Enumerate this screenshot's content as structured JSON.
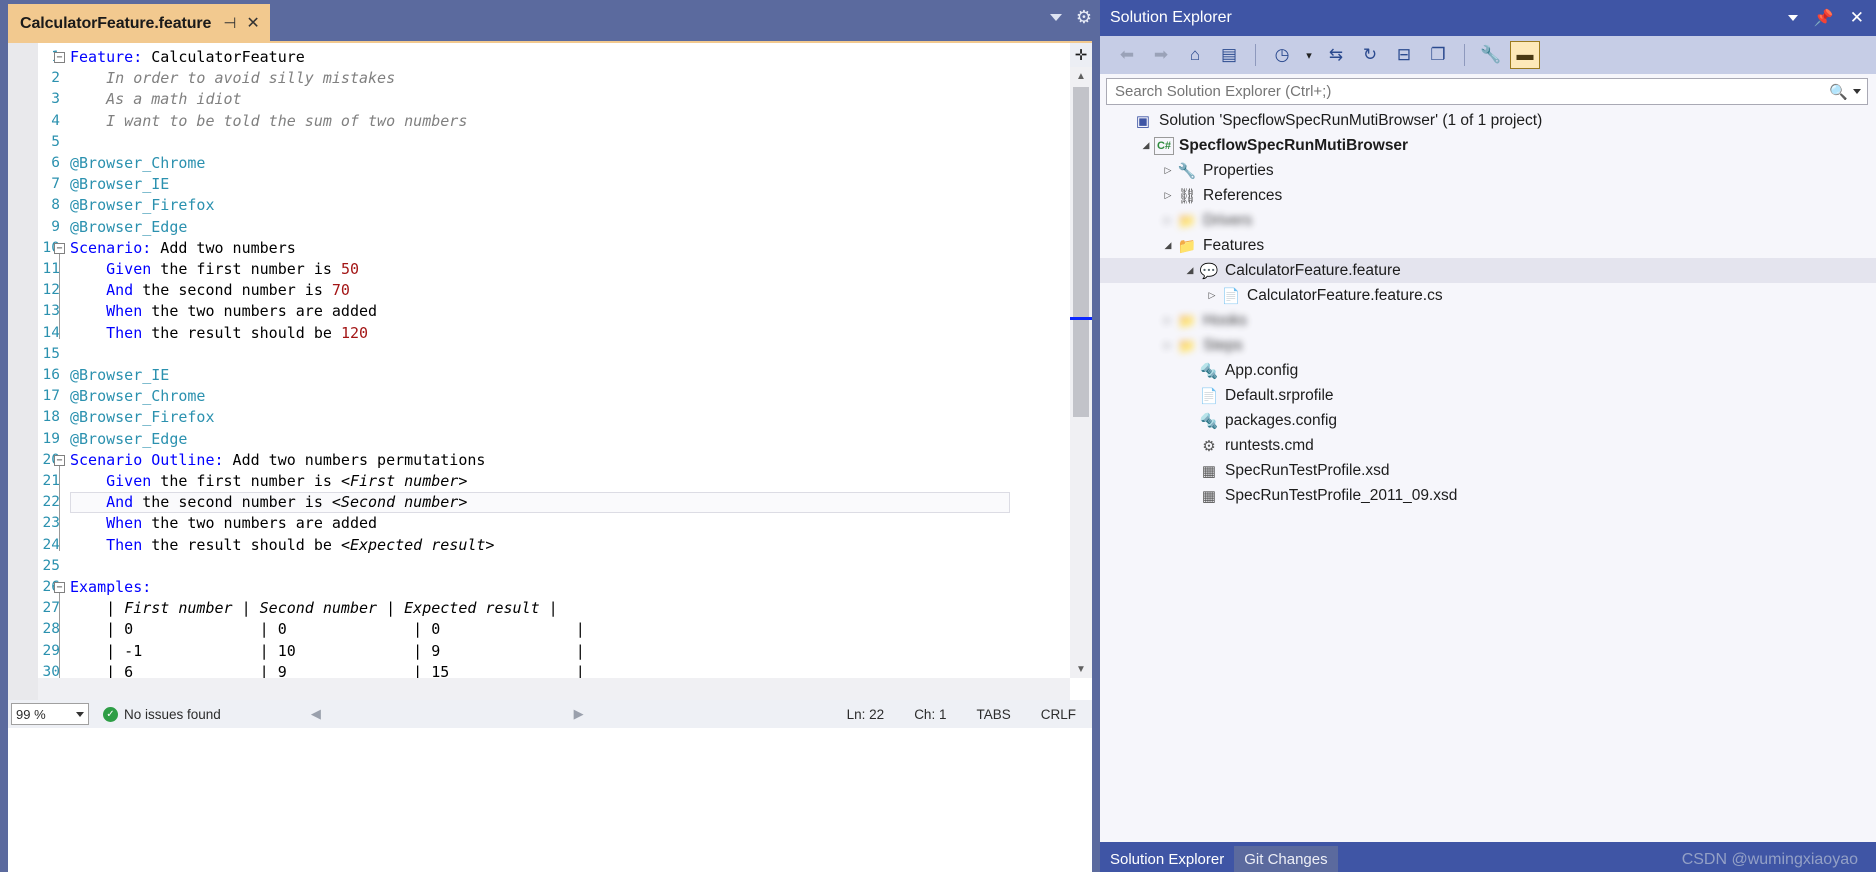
{
  "editor": {
    "tab": {
      "title": "CalculatorFeature.feature",
      "pin_icon": "⊣",
      "close_icon": "✕"
    },
    "window_caret_icon": "chevron-down-icon",
    "gear_icon": "⚙",
    "lines": [
      {
        "n": "1",
        "fold": "−",
        "segs": [
          {
            "t": "Feature:",
            "c": "kw"
          },
          {
            "t": " CalculatorFeature",
            "c": ""
          }
        ]
      },
      {
        "n": "2",
        "segs": [
          {
            "t": "    In order to avoid silly mistakes",
            "c": "it"
          }
        ]
      },
      {
        "n": "3",
        "segs": [
          {
            "t": "    As a math idiot",
            "c": "it"
          }
        ]
      },
      {
        "n": "4",
        "segs": [
          {
            "t": "    I want to be told the sum of two numbers",
            "c": "it"
          }
        ]
      },
      {
        "n": "5",
        "segs": [
          {
            "t": "",
            "c": ""
          }
        ]
      },
      {
        "n": "6",
        "segs": [
          {
            "t": "@Browser_Chrome",
            "c": "tag"
          }
        ]
      },
      {
        "n": "7",
        "segs": [
          {
            "t": "@Browser_IE",
            "c": "tag"
          }
        ]
      },
      {
        "n": "8",
        "segs": [
          {
            "t": "@Browser_Firefox",
            "c": "tag"
          }
        ]
      },
      {
        "n": "9",
        "segs": [
          {
            "t": "@Browser_Edge",
            "c": "tag"
          }
        ]
      },
      {
        "n": "10",
        "fold": "−",
        "segs": [
          {
            "t": "Scenario:",
            "c": "kw"
          },
          {
            "t": " Add two numbers",
            "c": ""
          }
        ]
      },
      {
        "n": "11",
        "segs": [
          {
            "t": "    Given",
            "c": "kw"
          },
          {
            "t": " the first number is ",
            "c": ""
          },
          {
            "t": "50",
            "c": "num"
          }
        ]
      },
      {
        "n": "12",
        "segs": [
          {
            "t": "    And",
            "c": "kw"
          },
          {
            "t": " the second number is ",
            "c": ""
          },
          {
            "t": "70",
            "c": "num"
          }
        ]
      },
      {
        "n": "13",
        "segs": [
          {
            "t": "    When",
            "c": "kw"
          },
          {
            "t": " the two numbers are added",
            "c": ""
          }
        ]
      },
      {
        "n": "14",
        "segs": [
          {
            "t": "    Then",
            "c": "kw"
          },
          {
            "t": " the result should be ",
            "c": ""
          },
          {
            "t": "120",
            "c": "num"
          }
        ]
      },
      {
        "n": "15",
        "segs": [
          {
            "t": "",
            "c": ""
          }
        ]
      },
      {
        "n": "16",
        "segs": [
          {
            "t": "@Browser_IE",
            "c": "tag"
          }
        ]
      },
      {
        "n": "17",
        "segs": [
          {
            "t": "@Browser_Chrome",
            "c": "tag"
          }
        ]
      },
      {
        "n": "18",
        "segs": [
          {
            "t": "@Browser_Firefox",
            "c": "tag"
          }
        ]
      },
      {
        "n": "19",
        "segs": [
          {
            "t": "@Browser_Edge",
            "c": "tag"
          }
        ]
      },
      {
        "n": "20",
        "fold": "−",
        "segs": [
          {
            "t": "Scenario Outline:",
            "c": "kw"
          },
          {
            "t": " Add two numbers permutations",
            "c": ""
          }
        ]
      },
      {
        "n": "21",
        "segs": [
          {
            "t": "    Given",
            "c": "kw"
          },
          {
            "t": " the first number is ",
            "c": ""
          },
          {
            "t": "<First number>",
            "c": "ph"
          }
        ]
      },
      {
        "n": "22",
        "current": true,
        "segs": [
          {
            "t": "    And",
            "c": "kw"
          },
          {
            "t": " the second number is ",
            "c": ""
          },
          {
            "t": "<Second number>",
            "c": "ph"
          }
        ]
      },
      {
        "n": "23",
        "segs": [
          {
            "t": "    When",
            "c": "kw"
          },
          {
            "t": " the two numbers are added",
            "c": ""
          }
        ]
      },
      {
        "n": "24",
        "segs": [
          {
            "t": "    Then",
            "c": "kw"
          },
          {
            "t": " the result should be ",
            "c": ""
          },
          {
            "t": "<Expected result>",
            "c": "ph"
          }
        ]
      },
      {
        "n": "25",
        "segs": [
          {
            "t": "",
            "c": ""
          }
        ]
      },
      {
        "n": "26",
        "fold": "−",
        "segs": [
          {
            "t": "Examples:",
            "c": "kw"
          }
        ]
      },
      {
        "n": "27",
        "segs": [
          {
            "t": "    | ",
            "c": ""
          },
          {
            "t": "First number",
            "c": "thead"
          },
          {
            "t": " | ",
            "c": ""
          },
          {
            "t": "Second number",
            "c": "thead"
          },
          {
            "t": " | ",
            "c": ""
          },
          {
            "t": "Expected result",
            "c": "thead"
          },
          {
            "t": " |",
            "c": ""
          }
        ]
      },
      {
        "n": "28",
        "segs": [
          {
            "t": "    | 0              | 0              | 0               |",
            "c": ""
          }
        ]
      },
      {
        "n": "29",
        "segs": [
          {
            "t": "    | -1             | 10             | 9               |",
            "c": ""
          }
        ]
      },
      {
        "n": "30",
        "segs": [
          {
            "t": "    | 6              | 9              | 15              |",
            "c": ""
          }
        ]
      },
      {
        "n": "31",
        "segs": [
          {
            "t": "",
            "c": ""
          }
        ]
      }
    ]
  },
  "statusbar": {
    "zoom": "99 %",
    "issues_icon": "✓",
    "issues": "No issues found",
    "line": "Ln: 22",
    "col": "Ch: 1",
    "tabs_mode": "TABS",
    "eol": "CRLF"
  },
  "solution_explorer": {
    "title": "Solution Explorer",
    "header_icons": [
      "chevron-down-icon",
      "pin-icon",
      "close-icon"
    ],
    "toolbar": [
      {
        "name": "back-icon",
        "glyph": "⬅"
      },
      {
        "name": "forward-icon",
        "glyph": "➡"
      },
      {
        "name": "home-icon",
        "glyph": "⌂"
      },
      {
        "name": "solution-views-icon",
        "glyph": "▤"
      },
      {
        "name": "pending-changes-icon",
        "glyph": "◷"
      },
      {
        "name": "dropdown-caret-icon",
        "glyph": "▾"
      },
      {
        "name": "sync-with-active-document-icon",
        "glyph": "⇆"
      },
      {
        "name": "refresh-icon",
        "glyph": "↻"
      },
      {
        "name": "collapse-all-icon",
        "glyph": "⊟"
      },
      {
        "name": "show-all-files-icon",
        "glyph": "❐"
      },
      {
        "name": "properties-wrench-icon",
        "glyph": "🔧"
      },
      {
        "name": "preview-selected-items-icon",
        "glyph": "▬"
      }
    ],
    "search": {
      "placeholder": "Search Solution Explorer (Ctrl+;)",
      "value": ""
    },
    "tree": [
      {
        "indent": 0,
        "expander": "",
        "icon": "solution-icon",
        "label": "Solution 'SpecflowSpecRunMutiBrowser' (1 of 1 project)",
        "bold": false,
        "selected": false,
        "blurred": false
      },
      {
        "indent": 1,
        "expander": "▲",
        "icon": "csharp-project-icon",
        "label": "SpecflowSpecRunMutiBrowser",
        "bold": true,
        "selected": false,
        "blurred": false
      },
      {
        "indent": 2,
        "expander": "▶",
        "icon": "wrench-icon",
        "label": "Properties",
        "bold": false,
        "selected": false,
        "blurred": false
      },
      {
        "indent": 2,
        "expander": "▶",
        "icon": "references-icon",
        "label": "References",
        "bold": false,
        "selected": false,
        "blurred": false
      },
      {
        "indent": 2,
        "expander": "▶",
        "icon": "folder-icon",
        "label": "Drivers",
        "bold": false,
        "selected": false,
        "blurred": true
      },
      {
        "indent": 2,
        "expander": "▲",
        "icon": "folder-icon",
        "label": "Features",
        "bold": false,
        "selected": false,
        "blurred": false
      },
      {
        "indent": 3,
        "expander": "▲",
        "icon": "feature-file-icon",
        "label": "CalculatorFeature.feature",
        "bold": false,
        "selected": true,
        "blurred": false
      },
      {
        "indent": 4,
        "expander": "▶",
        "icon": "generated-file-icon",
        "label": "CalculatorFeature.feature.cs",
        "bold": false,
        "selected": false,
        "blurred": false
      },
      {
        "indent": 2,
        "expander": "▶",
        "icon": "folder-icon",
        "label": "Hooks",
        "bold": false,
        "selected": false,
        "blurred": true
      },
      {
        "indent": 2,
        "expander": "▶",
        "icon": "folder-icon",
        "label": "Steps",
        "bold": false,
        "selected": false,
        "blurred": true
      },
      {
        "indent": 3,
        "expander": "",
        "icon": "config-file-icon",
        "label": "App.config",
        "bold": false,
        "selected": false,
        "blurred": false
      },
      {
        "indent": 3,
        "expander": "",
        "icon": "plain-file-icon",
        "label": "Default.srprofile",
        "bold": false,
        "selected": false,
        "blurred": false
      },
      {
        "indent": 3,
        "expander": "",
        "icon": "config-file-icon",
        "label": "packages.config",
        "bold": false,
        "selected": false,
        "blurred": false
      },
      {
        "indent": 3,
        "expander": "",
        "icon": "cmd-file-icon",
        "label": "runtests.cmd",
        "bold": false,
        "selected": false,
        "blurred": false
      },
      {
        "indent": 3,
        "expander": "",
        "icon": "xsd-file-icon",
        "label": "SpecRunTestProfile.xsd",
        "bold": false,
        "selected": false,
        "blurred": false
      },
      {
        "indent": 3,
        "expander": "",
        "icon": "xsd-file-icon",
        "label": "SpecRunTestProfile_2011_09.xsd",
        "bold": false,
        "selected": false,
        "blurred": false
      }
    ],
    "footer_tabs": [
      {
        "label": "Solution Explorer",
        "active": true
      },
      {
        "label": "Git Changes",
        "active": false
      }
    ],
    "watermark": "CSDN @wumingxiaoyao"
  },
  "colors": {
    "titlebar": "#3f55a5",
    "chrome": "#5b6a9e",
    "tab_active": "#f2c98f",
    "toolbar": "#c6cde6",
    "keyword": "#0000ff",
    "tag": "#2b91af",
    "number": "#a31515",
    "comment": "#808080",
    "selection": "#e4e4ee"
  }
}
